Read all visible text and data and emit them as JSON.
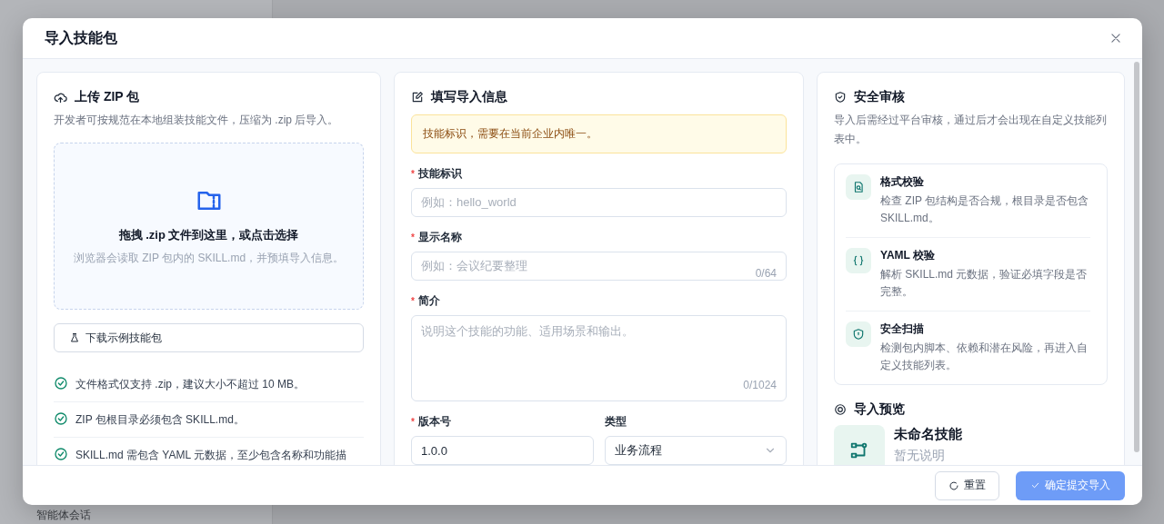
{
  "background": {
    "sidebar_item": "智能体会话"
  },
  "dialog": {
    "title": "导入技能包"
  },
  "upload": {
    "title": "上传 ZIP 包",
    "description": "开发者可按规范在本地组装技能文件，压缩为 .zip 后导入。",
    "dropzone": {
      "title": "拖拽 .zip 文件到这里，或点击选择",
      "hint": "浏览器会读取 ZIP 包内的 SKILL.md，并预填导入信息。"
    },
    "sample_button": "下载示例技能包",
    "rules": [
      {
        "text": "文件格式仅支持 .zip，建议大小不超过 10 MB。",
        "checked": true
      },
      {
        "text": "ZIP 包根目录必须包含 SKILL.md。",
        "checked": true
      },
      {
        "text": "SKILL.md 需包含 YAML 元数据，至少包含名称和功能描",
        "checked": true
      }
    ]
  },
  "form": {
    "title": "填写导入信息",
    "required_mark": "*",
    "notice": "技能标识，需要在当前企业内唯一。",
    "fields": [
      {
        "kind": "input",
        "label": "技能标识",
        "required": true,
        "placeholder": "例如：hello_world"
      },
      {
        "kind": "input",
        "label": "显示名称",
        "required": true,
        "placeholder": "例如：会议纪要整理",
        "counter": "0/64"
      },
      {
        "kind": "textarea",
        "label": "简介",
        "required": true,
        "placeholder": "说明这个技能的功能、适用场景和输出。",
        "counter": "0/1024"
      }
    ],
    "row": [
      {
        "kind": "input",
        "label": "版本号",
        "required": true,
        "value": "1.0.0"
      },
      {
        "kind": "select",
        "label": "类型",
        "required": false,
        "value": "业务流程"
      }
    ]
  },
  "review": {
    "title": "安全审核",
    "description": "导入后需经过平台审核，通过后才会出现在自定义技能列表中。",
    "steps": [
      {
        "kind": "file",
        "title": "格式校验",
        "text": "检查 ZIP 包结构是否合规，根目录是否包含 SKILL.md。"
      },
      {
        "kind": "braces",
        "title": "YAML 校验",
        "text": "解析 SKILL.md 元数据，验证必填字段是否完整。"
      },
      {
        "kind": "shield",
        "title": "安全扫描",
        "text": "检测包内脚本、依赖和潜在风险，再进入自定义技能列表。"
      }
    ],
    "preview_title": "导入预览",
    "preview": {
      "name": "未命名技能",
      "description": "暂无说明"
    }
  },
  "footer": {
    "reset": "重置",
    "submit": {
      "label": "确定提交导入",
      "disabled": true
    }
  }
}
